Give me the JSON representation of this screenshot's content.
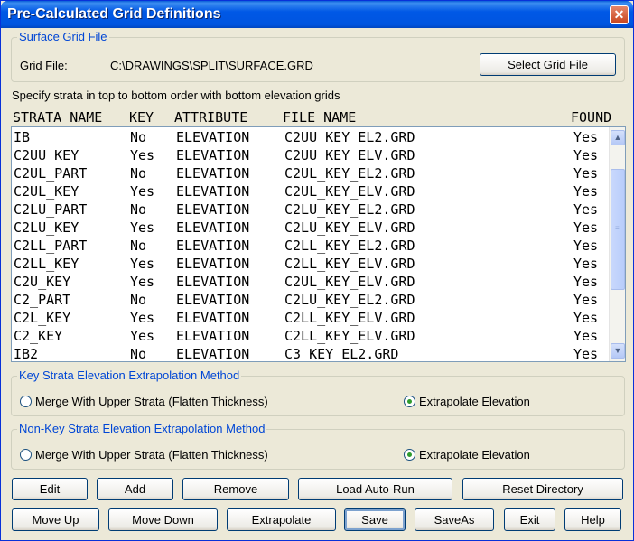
{
  "window": {
    "title": "Pre-Calculated Grid Definitions",
    "close_glyph": "✕"
  },
  "surface": {
    "group_title": "Surface Grid File",
    "grid_file_label": "Grid File:",
    "grid_file_path": "C:\\DRAWINGS\\SPLIT\\SURFACE.GRD",
    "select_button": "Select Grid File"
  },
  "instructions": "Specify strata in top to bottom order with bottom elevation grids",
  "table": {
    "headers": {
      "strata": "STRATA NAME",
      "key": "KEY",
      "attribute": "ATTRIBUTE",
      "file": "FILE NAME",
      "found": "FOUND"
    },
    "rows": [
      {
        "strata": "IB",
        "key": "No",
        "attribute": "ELEVATION",
        "file": "C2UU_KEY_EL2.GRD",
        "found": "Yes"
      },
      {
        "strata": "C2UU_KEY",
        "key": "Yes",
        "attribute": "ELEVATION",
        "file": "C2UU_KEY_ELV.GRD",
        "found": "Yes"
      },
      {
        "strata": "C2UL_PART",
        "key": "No",
        "attribute": "ELEVATION",
        "file": "C2UL_KEY_EL2.GRD",
        "found": "Yes"
      },
      {
        "strata": "C2UL_KEY",
        "key": "Yes",
        "attribute": "ELEVATION",
        "file": "C2UL_KEY_ELV.GRD",
        "found": "Yes"
      },
      {
        "strata": "C2LU_PART",
        "key": "No",
        "attribute": "ELEVATION",
        "file": "C2LU_KEY_EL2.GRD",
        "found": "Yes"
      },
      {
        "strata": "C2LU_KEY",
        "key": "Yes",
        "attribute": "ELEVATION",
        "file": "C2LU_KEY_ELV.GRD",
        "found": "Yes"
      },
      {
        "strata": "C2LL_PART",
        "key": "No",
        "attribute": "ELEVATION",
        "file": "C2LL_KEY_EL2.GRD",
        "found": "Yes"
      },
      {
        "strata": "C2LL_KEY",
        "key": "Yes",
        "attribute": "ELEVATION",
        "file": "C2LL_KEY_ELV.GRD",
        "found": "Yes"
      },
      {
        "strata": "C2U_KEY",
        "key": "Yes",
        "attribute": "ELEVATION",
        "file": "C2UL_KEY_ELV.GRD",
        "found": "Yes"
      },
      {
        "strata": "C2_PART",
        "key": "No",
        "attribute": "ELEVATION",
        "file": "C2LU_KEY_EL2.GRD",
        "found": "Yes"
      },
      {
        "strata": "C2L_KEY",
        "key": "Yes",
        "attribute": "ELEVATION",
        "file": "C2LL_KEY_ELV.GRD",
        "found": "Yes"
      },
      {
        "strata": "C2_KEY",
        "key": "Yes",
        "attribute": "ELEVATION",
        "file": "C2LL_KEY_ELV.GRD",
        "found": "Yes"
      },
      {
        "strata": "IB2",
        "key": "No",
        "attribute": "ELEVATION",
        "file": "C3_KEY_EL2.GRD",
        "found": "Yes"
      }
    ]
  },
  "key_method": {
    "group_title": "Key Strata Elevation Extrapolation Method",
    "option_merge": "Merge With Upper Strata (Flatten Thickness)",
    "option_extrapolate": "Extrapolate Elevation",
    "selected": "extrapolate"
  },
  "nonkey_method": {
    "group_title": "Non-Key Strata Elevation Extrapolation Method",
    "option_merge": "Merge With Upper Strata (Flatten Thickness)",
    "option_extrapolate": "Extrapolate Elevation",
    "selected": "extrapolate"
  },
  "buttons": {
    "edit": "Edit",
    "add": "Add",
    "remove": "Remove",
    "load_auto_run": "Load Auto-Run",
    "reset_directory": "Reset Directory",
    "move_up": "Move Up",
    "move_down": "Move Down",
    "extrapolate": "Extrapolate",
    "save": "Save",
    "save_as": "SaveAs",
    "exit": "Exit",
    "help": "Help"
  }
}
